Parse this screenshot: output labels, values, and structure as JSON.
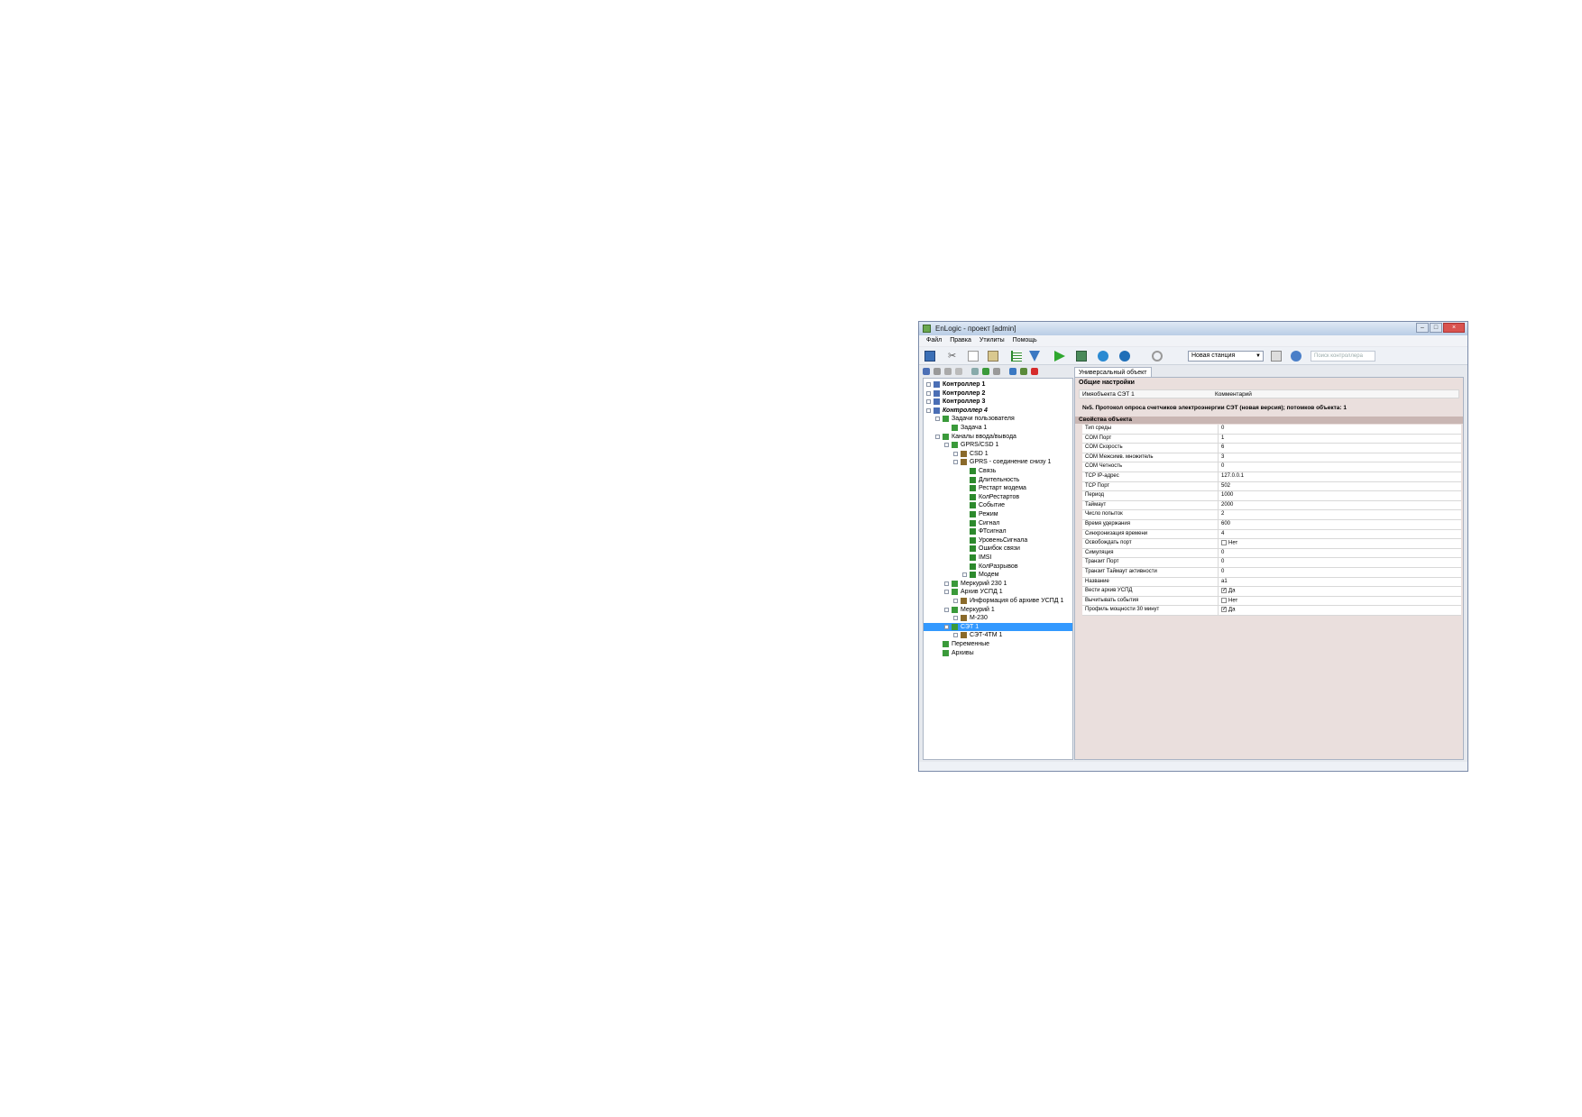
{
  "window": {
    "title": "EnLogic - проект [admin]"
  },
  "menu": [
    "Файл",
    "Правка",
    "Утилиты",
    "Помощь"
  ],
  "toolbar": {
    "station": "Новая станция",
    "search_placeholder": "Поиск контроллера"
  },
  "tab": {
    "label": "Универсальный объект"
  },
  "tree": [
    {
      "label": "Контроллер 1",
      "level": 0,
      "bold": true,
      "exp": "+"
    },
    {
      "label": "Контроллер 2",
      "level": 0,
      "bold": true,
      "exp": "+"
    },
    {
      "label": "Контроллер 3",
      "level": 0,
      "bold": true,
      "exp": "+"
    },
    {
      "label": "Контроллер 4",
      "level": 0,
      "bold": true,
      "italic": true,
      "exp": "-"
    },
    {
      "label": "Задачи пользователя",
      "level": 1,
      "exp": "-"
    },
    {
      "label": "Задача 1",
      "level": 2
    },
    {
      "label": "Каналы ввода/вывода",
      "level": 1,
      "exp": "-"
    },
    {
      "label": "GPRS/CSD 1",
      "level": 2,
      "exp": "-"
    },
    {
      "label": "CSD 1",
      "level": 3,
      "exp": "+"
    },
    {
      "label": "GPRS - соединение снизу 1",
      "level": 3,
      "exp": "-"
    },
    {
      "label": "Связь",
      "level": 4
    },
    {
      "label": "Длительность",
      "level": 4
    },
    {
      "label": "Рестарт модема",
      "level": 4
    },
    {
      "label": "КолРестартов",
      "level": 4
    },
    {
      "label": "Событие",
      "level": 4
    },
    {
      "label": "Режим",
      "level": 4
    },
    {
      "label": "Сигнал",
      "level": 4
    },
    {
      "label": "ФТсигнал",
      "level": 4
    },
    {
      "label": "УровеньСигнала",
      "level": 4
    },
    {
      "label": "Ошибок связи",
      "level": 4
    },
    {
      "label": "IMSI",
      "level": 4
    },
    {
      "label": "КолРазрывов",
      "level": 4
    },
    {
      "label": "Модем",
      "level": 4,
      "exp": "+"
    },
    {
      "label": "Меркурий 230 1",
      "level": 2,
      "exp": "+"
    },
    {
      "label": "Архив УСПД 1",
      "level": 2,
      "exp": "-"
    },
    {
      "label": "Информация об архиве УСПД 1",
      "level": 3,
      "exp": "+"
    },
    {
      "label": "Меркурий 1",
      "level": 2,
      "exp": "-"
    },
    {
      "label": "М-230",
      "level": 3,
      "exp": "+"
    },
    {
      "label": "СЭТ 1",
      "level": 2,
      "exp": "-",
      "selected": true
    },
    {
      "label": "СЭТ-4ТМ 1",
      "level": 3,
      "exp": "+"
    },
    {
      "label": "Переменные",
      "level": 1
    },
    {
      "label": "Архивы",
      "level": 1
    }
  ],
  "general": {
    "title": "Общие настройки",
    "name_label": "Имяобъекта",
    "name_value": "СЭТ 1",
    "comment_label": "Комментарий",
    "protocol": "№5. Протокол опроса счетчиков электроэнергии СЭТ (новая версия); потомков объекта: 1"
  },
  "properties": {
    "title": "Свойства объекта",
    "rows": [
      {
        "name": "Тип среды",
        "value": "0"
      },
      {
        "name": "COM Порт",
        "value": "1"
      },
      {
        "name": "COM Скорость",
        "value": "6"
      },
      {
        "name": "COM Межсимв. множитель",
        "value": "3"
      },
      {
        "name": "COM Четность",
        "value": "0"
      },
      {
        "name": "TCP IP-адрес",
        "value": "127.0.0.1"
      },
      {
        "name": "TCP Порт",
        "value": "502"
      },
      {
        "name": "Период",
        "value": "1000"
      },
      {
        "name": "Таймаут",
        "value": "2000"
      },
      {
        "name": "Число попыток",
        "value": "2"
      },
      {
        "name": "Время удержания",
        "value": "600"
      },
      {
        "name": "Синхронизация времени",
        "value": "4"
      },
      {
        "name": "Освобождать порт",
        "value": "Нет",
        "checkbox": false
      },
      {
        "name": "Симуляция",
        "value": "0"
      },
      {
        "name": "Транзит Порт",
        "value": "0"
      },
      {
        "name": "Транзит Таймаут активности",
        "value": "0"
      },
      {
        "name": "Название",
        "value": "a1"
      },
      {
        "name": "Вести архив УСПД",
        "value": "Да",
        "checkbox": true
      },
      {
        "name": "Вычитывать события",
        "value": "Нет",
        "checkbox": false
      },
      {
        "name": "Профиль мощности 30 минут",
        "value": "Да",
        "checkbox": true
      }
    ]
  }
}
